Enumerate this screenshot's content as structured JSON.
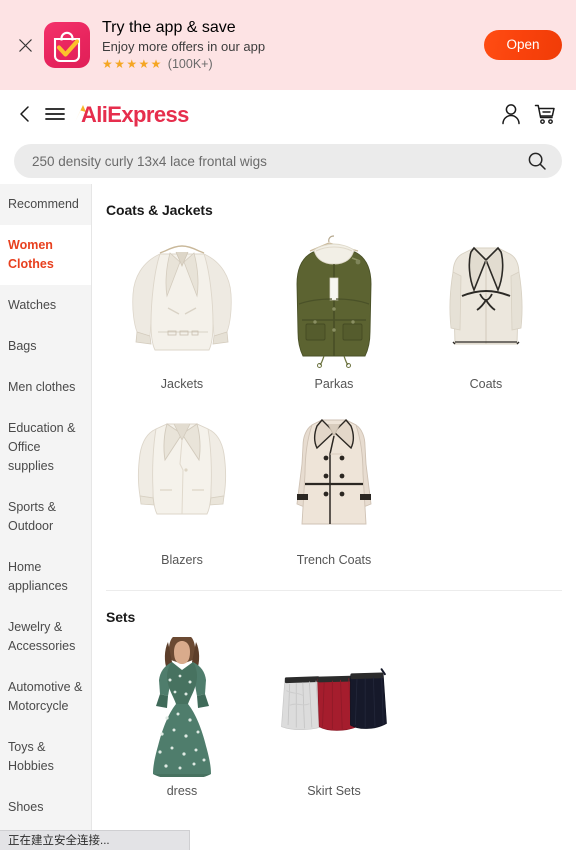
{
  "app_banner": {
    "close_icon": "close-icon",
    "app_icon": "aliexpress-app-icon",
    "title": "Try the app & save",
    "subtitle": "Enjoy more offers in our app",
    "stars": "★★★★★",
    "rating_count": "(100K+)",
    "open_label": "Open",
    "background_color": "#fde3e4",
    "open_button_color": "#f9420c"
  },
  "header": {
    "back_icon": "back-chevron-icon",
    "menu_icon": "hamburger-menu-icon",
    "logo_text": "AliExpress",
    "logo_color": "#e62e4d",
    "logo_accent_color": "#f7b52a",
    "account_icon": "account-person-icon",
    "cart_icon": "shopping-cart-icon"
  },
  "search": {
    "value": "250 density curly 13x4 lace frontal wigs",
    "placeholder": "250 density curly 13x4 lace frontal wigs",
    "search_icon": "search-magnifier-icon"
  },
  "sidebar": {
    "active_color": "#e8401f",
    "items": [
      {
        "label": "Recommend",
        "active": false
      },
      {
        "label": "Women Clothes",
        "active": true
      },
      {
        "label": "Watches",
        "active": false
      },
      {
        "label": "Bags",
        "active": false
      },
      {
        "label": "Men clothes",
        "active": false
      },
      {
        "label": "Education & Office supplies",
        "active": false
      },
      {
        "label": "Sports & Outdoor",
        "active": false
      },
      {
        "label": "Home appliances",
        "active": false
      },
      {
        "label": "Jewelry & Accessories",
        "active": false
      },
      {
        "label": "Automotive & Motorcycle",
        "active": false
      },
      {
        "label": "Toys & Hobbies",
        "active": false
      },
      {
        "label": "Shoes",
        "active": false
      }
    ]
  },
  "main": {
    "sections": [
      {
        "title": "Coats & Jackets",
        "items": [
          {
            "label": "Jackets",
            "image": "cream-shearling-jacket"
          },
          {
            "label": "Parkas",
            "image": "olive-fur-collar-parka"
          },
          {
            "label": "Coats",
            "image": "beige-belted-long-coat"
          },
          {
            "label": "Blazers",
            "image": "cream-blazer"
          },
          {
            "label": "Trench Coats",
            "image": "beige-double-breasted-trench"
          }
        ]
      },
      {
        "title": "Sets",
        "items": [
          {
            "label": "dress",
            "image": "green-floral-maxi-dress"
          },
          {
            "label": "Skirt Sets",
            "image": "three-color-skirt-set"
          }
        ]
      }
    ]
  },
  "statusbar": {
    "text": "正在建立安全连接..."
  }
}
